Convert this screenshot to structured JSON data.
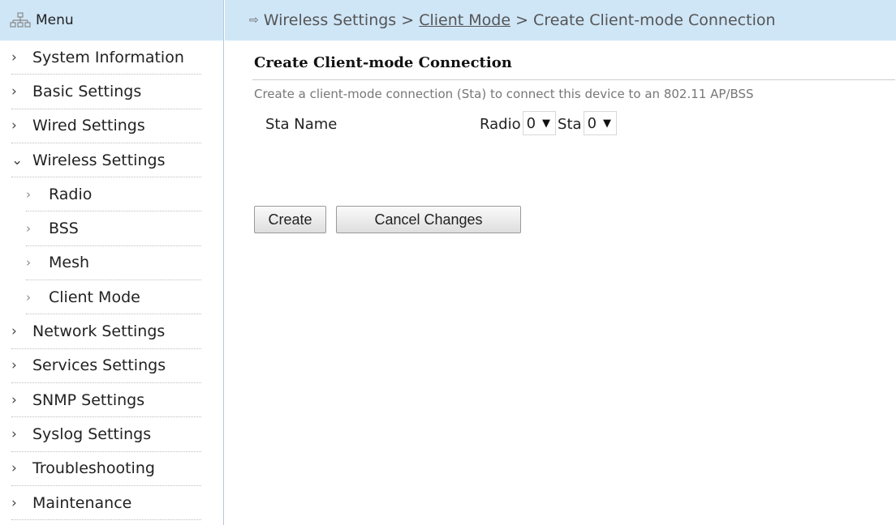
{
  "sidebar": {
    "header": "Menu",
    "items": [
      {
        "label": "System Information",
        "sub": false,
        "expanded": false
      },
      {
        "label": "Basic Settings",
        "sub": false,
        "expanded": false
      },
      {
        "label": "Wired Settings",
        "sub": false,
        "expanded": false
      },
      {
        "label": "Wireless Settings",
        "sub": false,
        "expanded": true
      },
      {
        "label": "Radio",
        "sub": true,
        "expanded": false
      },
      {
        "label": "BSS",
        "sub": true,
        "expanded": false
      },
      {
        "label": "Mesh",
        "sub": true,
        "expanded": false
      },
      {
        "label": "Client Mode",
        "sub": true,
        "expanded": false
      },
      {
        "label": "Network Settings",
        "sub": false,
        "expanded": false
      },
      {
        "label": "Services Settings",
        "sub": false,
        "expanded": false
      },
      {
        "label": "SNMP Settings",
        "sub": false,
        "expanded": false
      },
      {
        "label": "Syslog Settings",
        "sub": false,
        "expanded": false
      },
      {
        "label": "Troubleshooting",
        "sub": false,
        "expanded": false
      },
      {
        "label": "Maintenance",
        "sub": false,
        "expanded": false
      }
    ]
  },
  "breadcrumb": {
    "part1": "Wireless Settings",
    "sep": ">",
    "part2": "Client Mode",
    "part3": "Create Client-mode Connection"
  },
  "main": {
    "title": "Create Client-mode Connection",
    "description": "Create a client-mode connection (Sta) to connect this device to an 802.11 AP/BSS",
    "sta_name_label": "Sta Name",
    "radio_label": "Radio",
    "radio_value": "0",
    "sta_label": "Sta",
    "sta_value": "0",
    "create_label": "Create",
    "cancel_label": "Cancel Changes"
  },
  "colors": {
    "header_bg": "#cfe6f7",
    "divider": "#b9c9d6"
  },
  "icons": {
    "menu": "sitemap-icon",
    "chevron_right": "chevron-right-icon",
    "chevron_down": "chevron-down-icon",
    "breadcrumb_arrow": "arrow-right-icon",
    "dropdown": "caret-down-icon"
  }
}
